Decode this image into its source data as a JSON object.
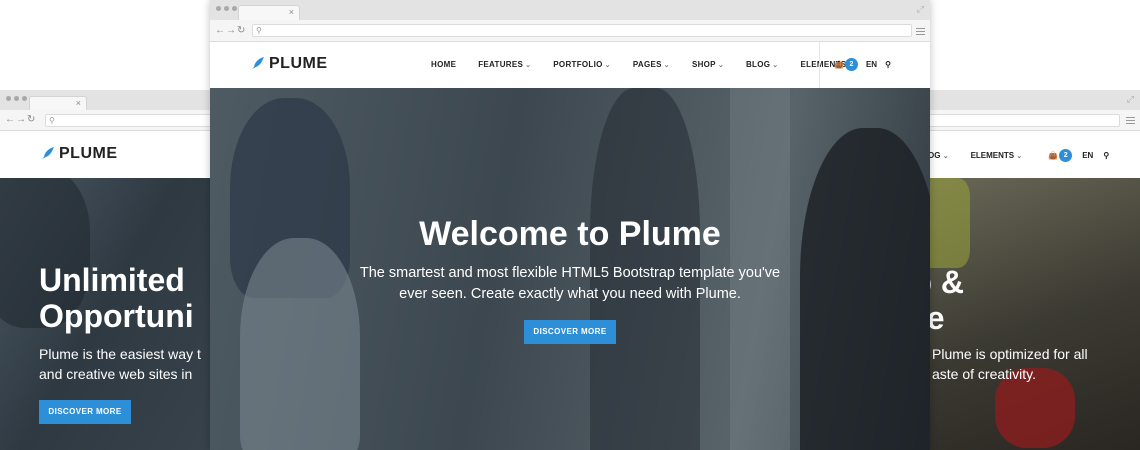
{
  "brand": {
    "name": "PLUME",
    "accent": "#2d8fd8"
  },
  "nav_items": [
    {
      "label": "HOME",
      "has_dropdown": false
    },
    {
      "label": "FEATURES",
      "has_dropdown": true
    },
    {
      "label": "PORTFOLIO",
      "has_dropdown": true
    },
    {
      "label": "PAGES",
      "has_dropdown": true
    },
    {
      "label": "SHOP",
      "has_dropdown": true
    },
    {
      "label": "BLOG",
      "has_dropdown": true
    },
    {
      "label": "ELEMENTS",
      "has_dropdown": true
    }
  ],
  "cart": {
    "count": "2",
    "icon": "shopping-bag-icon"
  },
  "language": "EN",
  "search_icon": "search-icon",
  "left_window": {
    "title_line1": "Unlimited",
    "title_line2": "Opportuni",
    "text_line1": "Plume is the easiest way t",
    "text_line2": "and creative web sites in",
    "button_label": "DISCOVER MORE"
  },
  "center_window": {
    "title": "Welcome to Plume",
    "text_line1": "The smartest and most flexible HTML5 Bootstrap template you've",
    "text_line2": "ever seen. Create exactly what you need with Plume.",
    "button_label": "DISCOVER MORE"
  },
  "right_window": {
    "nav_fragment": "OG",
    "nav_elements": "ELEMENTS",
    "title_line1": "rp &",
    "title_line2": "ive",
    "text_line1": "Plume is optimized for all",
    "text_line2": "aste of creativity."
  }
}
